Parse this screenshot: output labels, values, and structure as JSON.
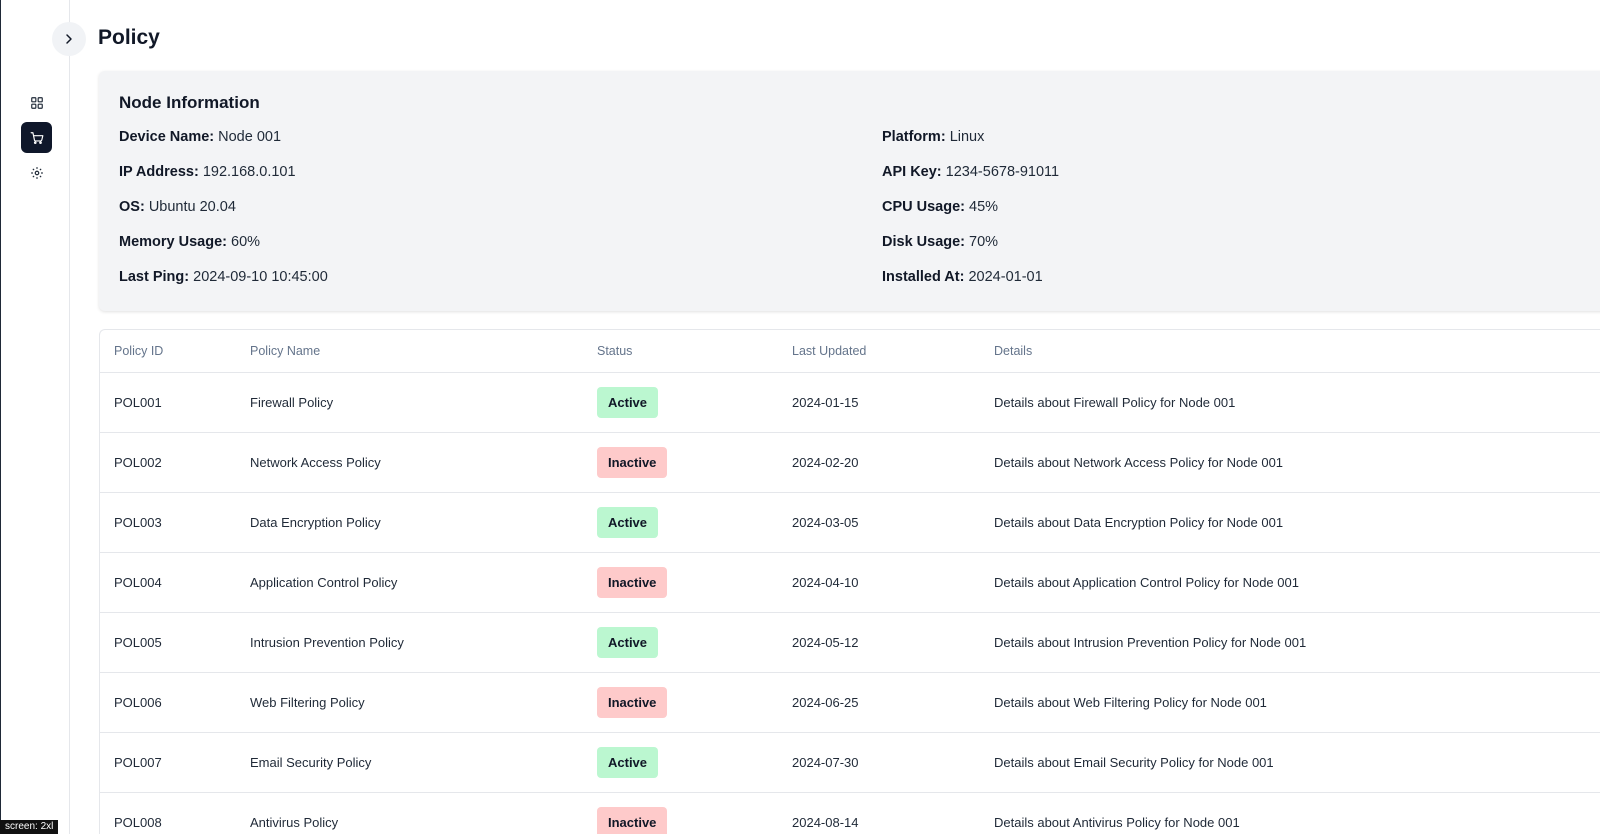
{
  "page": {
    "title": "Policy"
  },
  "sidebar": {
    "items": [
      {
        "icon": "dashboard-icon",
        "active": false
      },
      {
        "icon": "cart-icon",
        "active": true
      },
      {
        "icon": "gear-icon",
        "active": false
      }
    ]
  },
  "node_info": {
    "heading": "Node Information",
    "left": [
      {
        "label": "Device Name:",
        "value": "Node 001"
      },
      {
        "label": "IP Address:",
        "value": "192.168.0.101"
      },
      {
        "label": "OS:",
        "value": "Ubuntu 20.04"
      },
      {
        "label": "Memory Usage:",
        "value": "60%"
      },
      {
        "label": "Last Ping:",
        "value": "2024-09-10 10:45:00"
      }
    ],
    "right": [
      {
        "label": "Platform:",
        "value": "Linux"
      },
      {
        "label": "API Key:",
        "value": "1234-5678-91011"
      },
      {
        "label": "CPU Usage:",
        "value": "45%"
      },
      {
        "label": "Disk Usage:",
        "value": "70%"
      },
      {
        "label": "Installed At:",
        "value": "2024-01-01"
      }
    ]
  },
  "table": {
    "headers": [
      "Policy ID",
      "Policy Name",
      "Status",
      "Last Updated",
      "Details"
    ],
    "rows": [
      [
        "POL001",
        "Firewall Policy",
        "Active",
        "2024-01-15",
        "Details about Firewall Policy for Node 001"
      ],
      [
        "POL002",
        "Network Access Policy",
        "Inactive",
        "2024-02-20",
        "Details about Network Access Policy for Node 001"
      ],
      [
        "POL003",
        "Data Encryption Policy",
        "Active",
        "2024-03-05",
        "Details about Data Encryption Policy for Node 001"
      ],
      [
        "POL004",
        "Application Control Policy",
        "Inactive",
        "2024-04-10",
        "Details about Application Control Policy for Node 001"
      ],
      [
        "POL005",
        "Intrusion Prevention Policy",
        "Active",
        "2024-05-12",
        "Details about Intrusion Prevention Policy for Node 001"
      ],
      [
        "POL006",
        "Web Filtering Policy",
        "Inactive",
        "2024-06-25",
        "Details about Web Filtering Policy for Node 001"
      ],
      [
        "POL007",
        "Email Security Policy",
        "Active",
        "2024-07-30",
        "Details about Email Security Policy for Node 001"
      ],
      [
        "POL008",
        "Antivirus Policy",
        "Inactive",
        "2024-08-14",
        "Details about Antivirus Policy for Node 001"
      ]
    ]
  },
  "status_colors": {
    "Active": "#bbf7d0",
    "Inactive": "#fecaca"
  },
  "screen_indicator": "screen: 2xl"
}
